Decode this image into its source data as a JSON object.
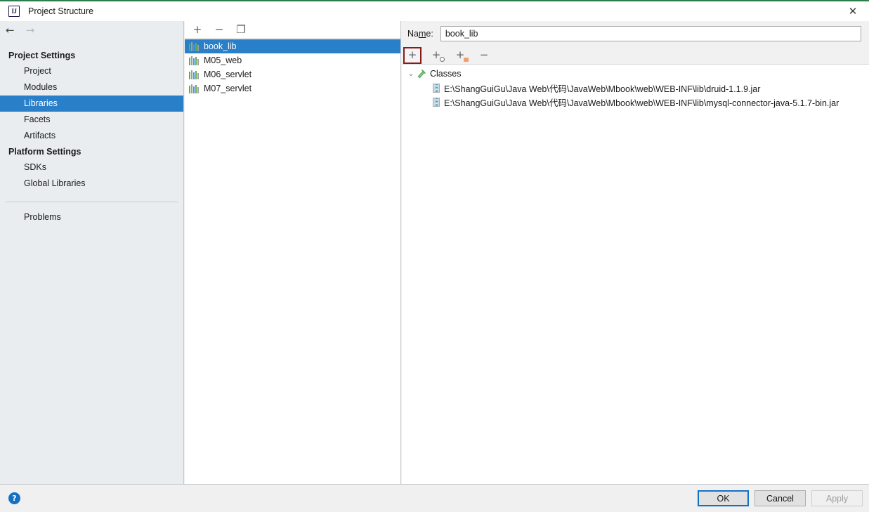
{
  "window": {
    "title": "Project Structure",
    "app_icon": "IJ",
    "close_icon": "✕",
    "accent_color": "#2a7fc9",
    "title_border_color": "#2e7d4f",
    "highlight_color": "#8b1a1a"
  },
  "nav": {
    "back_icon": "←",
    "forward_icon": "→"
  },
  "sidebar": {
    "groups": [
      {
        "title": "Project Settings",
        "items": [
          {
            "label": "Project",
            "selected": false
          },
          {
            "label": "Modules",
            "selected": false
          },
          {
            "label": "Libraries",
            "selected": true
          },
          {
            "label": "Facets",
            "selected": false
          },
          {
            "label": "Artifacts",
            "selected": false
          }
        ]
      },
      {
        "title": "Platform Settings",
        "items": [
          {
            "label": "SDKs",
            "selected": false
          },
          {
            "label": "Global Libraries",
            "selected": false
          }
        ]
      }
    ],
    "problems_label": "Problems"
  },
  "mid_panel": {
    "toolbar": [
      {
        "name": "add-library-button",
        "glyph": "+"
      },
      {
        "name": "remove-library-button",
        "glyph": "−"
      },
      {
        "name": "copy-library-button",
        "glyph": "❐"
      }
    ],
    "libraries": [
      {
        "label": "book_lib",
        "selected": true
      },
      {
        "label": "M05_web",
        "selected": false
      },
      {
        "label": "M06_servlet",
        "selected": false
      },
      {
        "label": "M07_servlet",
        "selected": false
      }
    ]
  },
  "right_panel": {
    "name_label_before": "Na",
    "name_label_mnemonic": "m",
    "name_label_after": "e:",
    "name_value": "book_lib",
    "name_placeholder": "",
    "toolbar": [
      {
        "name": "add-jar-button",
        "glyph": "+",
        "badge": "none",
        "highlighted": true
      },
      {
        "name": "add-from-maven-button",
        "glyph": "+",
        "badge": "globe",
        "highlighted": false
      },
      {
        "name": "add-from-folder-button",
        "glyph": "+",
        "badge": "folder",
        "highlighted": false
      },
      {
        "name": "remove-entry-button",
        "glyph": "−",
        "badge": "none",
        "highlighted": false
      }
    ],
    "tree": {
      "root_label": "Classes",
      "chevron_glyph": "⌄",
      "entries": [
        "E:\\ShangGuiGu\\Java Web\\代码\\JavaWeb\\Mbook\\web\\WEB-INF\\lib\\druid-1.1.9.jar",
        "E:\\ShangGuiGu\\Java Web\\代码\\JavaWeb\\Mbook\\web\\WEB-INF\\lib\\mysql-connector-java-5.1.7-bin.jar"
      ]
    }
  },
  "bottom": {
    "help_glyph": "?",
    "buttons": [
      {
        "label": "OK",
        "state": "default"
      },
      {
        "label": "Cancel",
        "state": "normal"
      },
      {
        "label": "Apply",
        "state": "disabled"
      }
    ]
  }
}
